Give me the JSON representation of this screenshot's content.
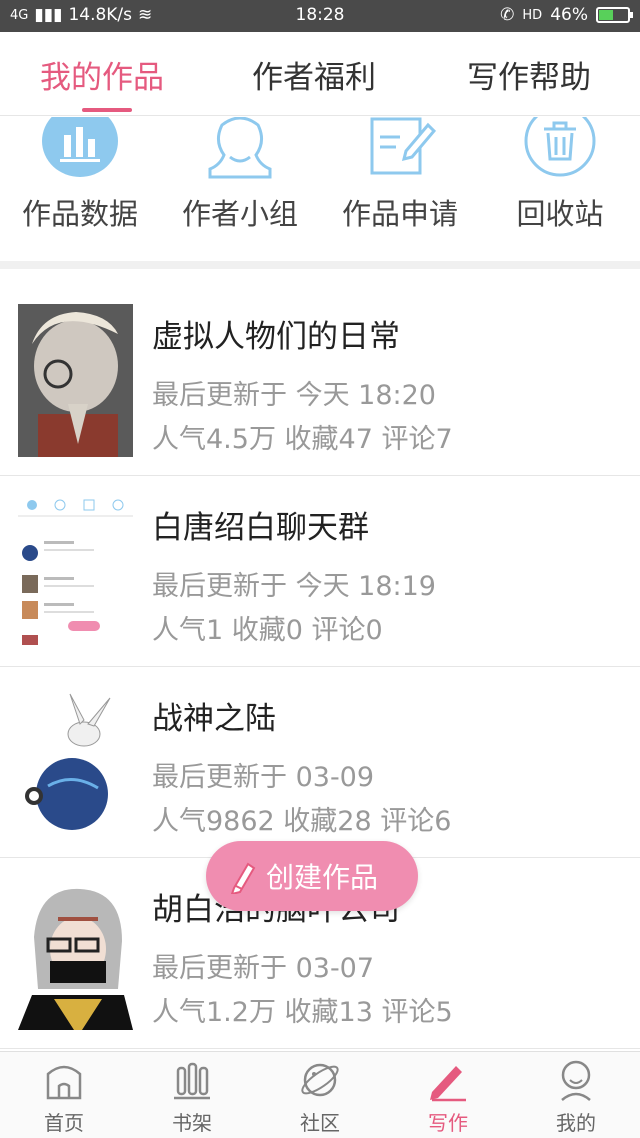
{
  "status_bar": {
    "network": "4G",
    "speed": "14.8K/s",
    "time": "18:28",
    "call_badge": "HD",
    "battery": "46%",
    "battery_level": 0.46
  },
  "top_tabs": [
    {
      "label": "我的作品",
      "active": true
    },
    {
      "label": "作者福利",
      "active": false
    },
    {
      "label": "写作帮助",
      "active": false
    }
  ],
  "quick_actions": [
    {
      "label": "作品数据",
      "icon": "bar-chart-icon"
    },
    {
      "label": "作者小组",
      "icon": "group-icon"
    },
    {
      "label": "作品申请",
      "icon": "edit-form-icon"
    },
    {
      "label": "回收站",
      "icon": "trash-icon"
    }
  ],
  "works": [
    {
      "title": "虚拟人物们的日常",
      "updated": "最后更新于 今天 18:20",
      "stats": "人气4.5万 收藏47 评论7"
    },
    {
      "title": "白唐绍白聊天群",
      "updated": "最后更新于 今天 18:19",
      "stats": "人气1 收藏0 评论0"
    },
    {
      "title": "战神之陆",
      "updated": "最后更新于 03-09",
      "stats": "人气9862 收藏28 评论6"
    },
    {
      "title": "胡白浩的脑叶公司",
      "updated": "最后更新于 03-07",
      "stats": "人气1.2万 收藏13 评论5"
    }
  ],
  "create_button": {
    "label": "创建作品"
  },
  "bottom_nav": [
    {
      "label": "首页",
      "icon": "home-icon",
      "active": false
    },
    {
      "label": "书架",
      "icon": "bookshelf-icon",
      "active": false
    },
    {
      "label": "社区",
      "icon": "planet-icon",
      "active": false
    },
    {
      "label": "写作",
      "icon": "pen-icon",
      "active": true
    },
    {
      "label": "我的",
      "icon": "profile-icon",
      "active": false
    }
  ],
  "colors": {
    "accent": "#e55a7f",
    "accent_light": "#f08db0",
    "icon_blue": "#8ec9ee",
    "muted": "#999999"
  }
}
